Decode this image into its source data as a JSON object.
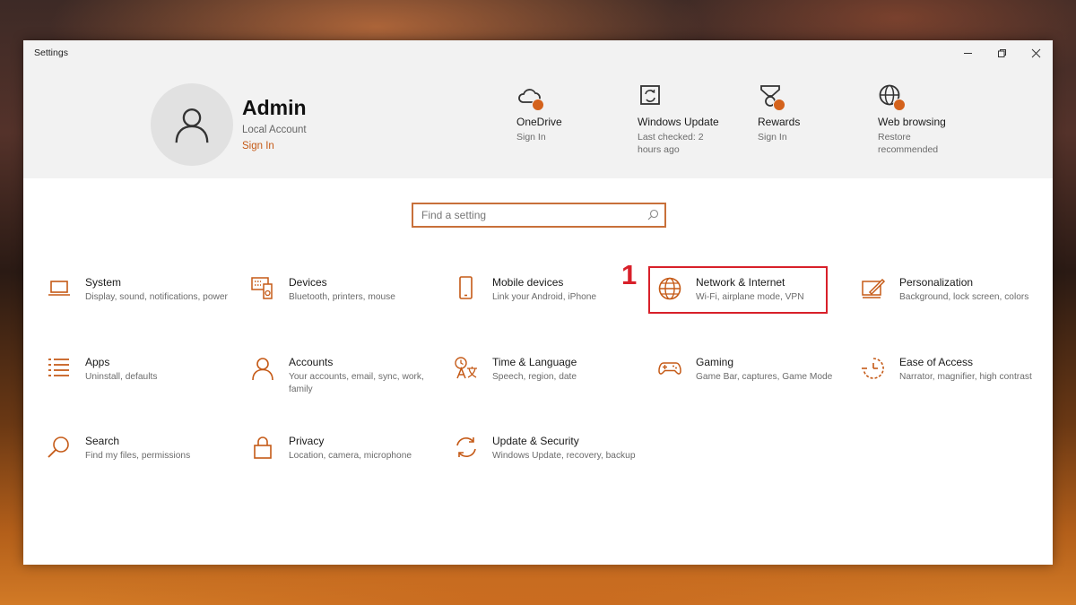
{
  "window": {
    "title": "Settings"
  },
  "account": {
    "name": "Admin",
    "type": "Local Account",
    "sign_in": "Sign In"
  },
  "header_items": [
    {
      "label": "OneDrive",
      "sub": "Sign In",
      "icon": "cloud-icon"
    },
    {
      "label": "Windows Update",
      "sub": "Last checked: 2 hours ago",
      "icon": "update-icon"
    },
    {
      "label": "Rewards",
      "sub": "Sign In",
      "icon": "medal-icon"
    },
    {
      "label": "Web browsing",
      "sub": "Restore recommended",
      "icon": "globe-icon"
    }
  ],
  "search": {
    "placeholder": "Find a setting"
  },
  "tiles": [
    {
      "name": "System",
      "desc": "Display, sound, notifications, power",
      "icon": "laptop-icon"
    },
    {
      "name": "Devices",
      "desc": "Bluetooth, printers, mouse",
      "icon": "keyboard-icon"
    },
    {
      "name": "Mobile devices",
      "desc": "Link your Android, iPhone",
      "icon": "phone-icon"
    },
    {
      "name": "Network & Internet",
      "desc": "Wi-Fi, airplane mode, VPN",
      "icon": "globe-icon"
    },
    {
      "name": "Personalization",
      "desc": "Background, lock screen, colors",
      "icon": "paint-icon"
    },
    {
      "name": "Apps",
      "desc": "Uninstall, defaults",
      "icon": "list-icon"
    },
    {
      "name": "Accounts",
      "desc": "Your accounts, email, sync, work, family",
      "icon": "person-icon"
    },
    {
      "name": "Time & Language",
      "desc": "Speech, region, date",
      "icon": "language-icon"
    },
    {
      "name": "Gaming",
      "desc": "Game Bar, captures, Game Mode",
      "icon": "gamepad-icon"
    },
    {
      "name": "Ease of Access",
      "desc": "Narrator, magnifier, high contrast",
      "icon": "timer-icon"
    },
    {
      "name": "Search",
      "desc": "Find my files, permissions",
      "icon": "search-icon"
    },
    {
      "name": "Privacy",
      "desc": "Location, camera, microphone",
      "icon": "lock-icon"
    },
    {
      "name": "Update & Security",
      "desc": "Windows Update, recovery, backup",
      "icon": "sync-icon"
    }
  ],
  "annotation": {
    "step": "1"
  },
  "colors": {
    "accent": "#c55a17",
    "highlight": "#d8202a",
    "header_bg": "#f2f2f2"
  }
}
